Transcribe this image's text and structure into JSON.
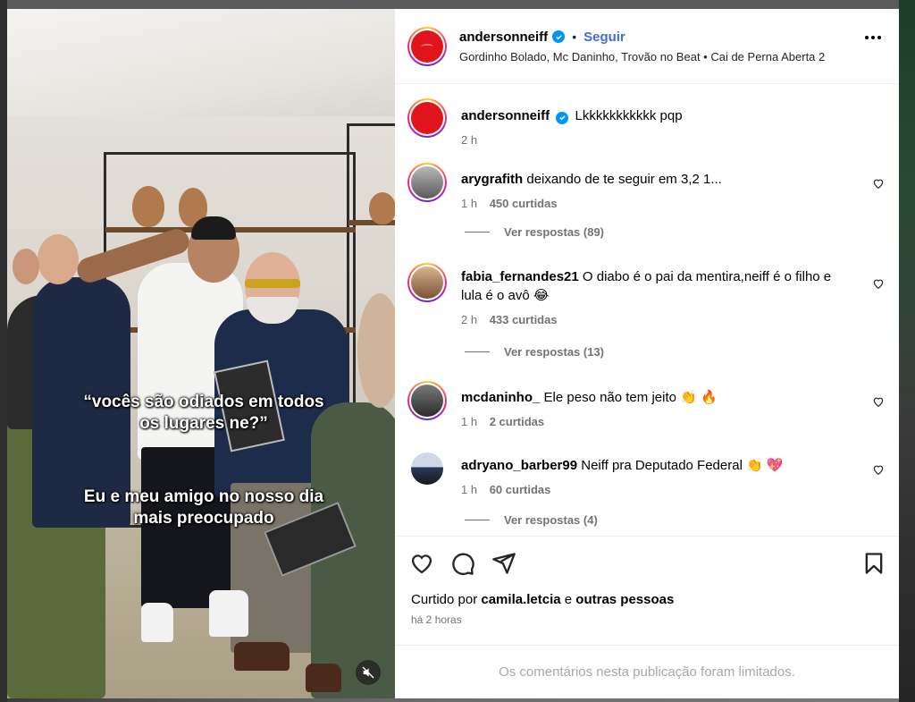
{
  "post": {
    "author": "andersonneiff",
    "follow_label": "Seguir",
    "separator": "•",
    "music": "Gordinho Bolado, Mc Daninho, Trovão no Beat • Cai de Perna Aberta 2",
    "caption_text": "Lkkkkkkkkkkk pqp",
    "caption_time": "2 h",
    "video_caption_1": "“vocês são odiados em todos\nos lugares ne?”",
    "video_caption_2": "Eu e meu amigo no nosso dia\nmais preocupado"
  },
  "comments": [
    {
      "user": "arygrafith",
      "text": "deixando de te seguir em 3,2 1...",
      "time": "1 h",
      "likes": "450 curtidas",
      "replies": "Ver respostas (89)"
    },
    {
      "user": "fabia_fernandes21",
      "text": "O diabo é o pai da mentira,neiff é o filho e lula é o avô 😂",
      "time": "2 h",
      "likes": "433 curtidas",
      "replies": "Ver respostas (13)"
    },
    {
      "user": "mcdaninho_",
      "text": "Ele peso não tem jeito 👏 🔥",
      "time": "1 h",
      "likes": "2 curtidas",
      "replies": ""
    },
    {
      "user": "adryano_barber99",
      "text": "Neiff pra Deputado Federal 👏 💖",
      "time": "1 h",
      "likes": "60 curtidas",
      "replies": "Ver respostas (4)"
    }
  ],
  "actions": {
    "liked_prefix": "Curtido por",
    "liked_user": "camila.letcia",
    "liked_and": "e",
    "liked_others": "outras pessoas",
    "time": "há 2 horas",
    "limited_notice": "Os comentários nesta publicação foram limitados."
  },
  "icons": {
    "more": "more-horizontal-icon",
    "verified": "verified-badge-icon",
    "like": "heart-icon",
    "comment": "comment-icon",
    "share": "send-icon",
    "save": "bookmark-icon",
    "mute": "speaker-muted-icon"
  },
  "colors": {
    "accent": "#0095f6",
    "follow": "#3f6ce0",
    "muted_text": "#737373",
    "avatar_red": "#e0141b"
  }
}
